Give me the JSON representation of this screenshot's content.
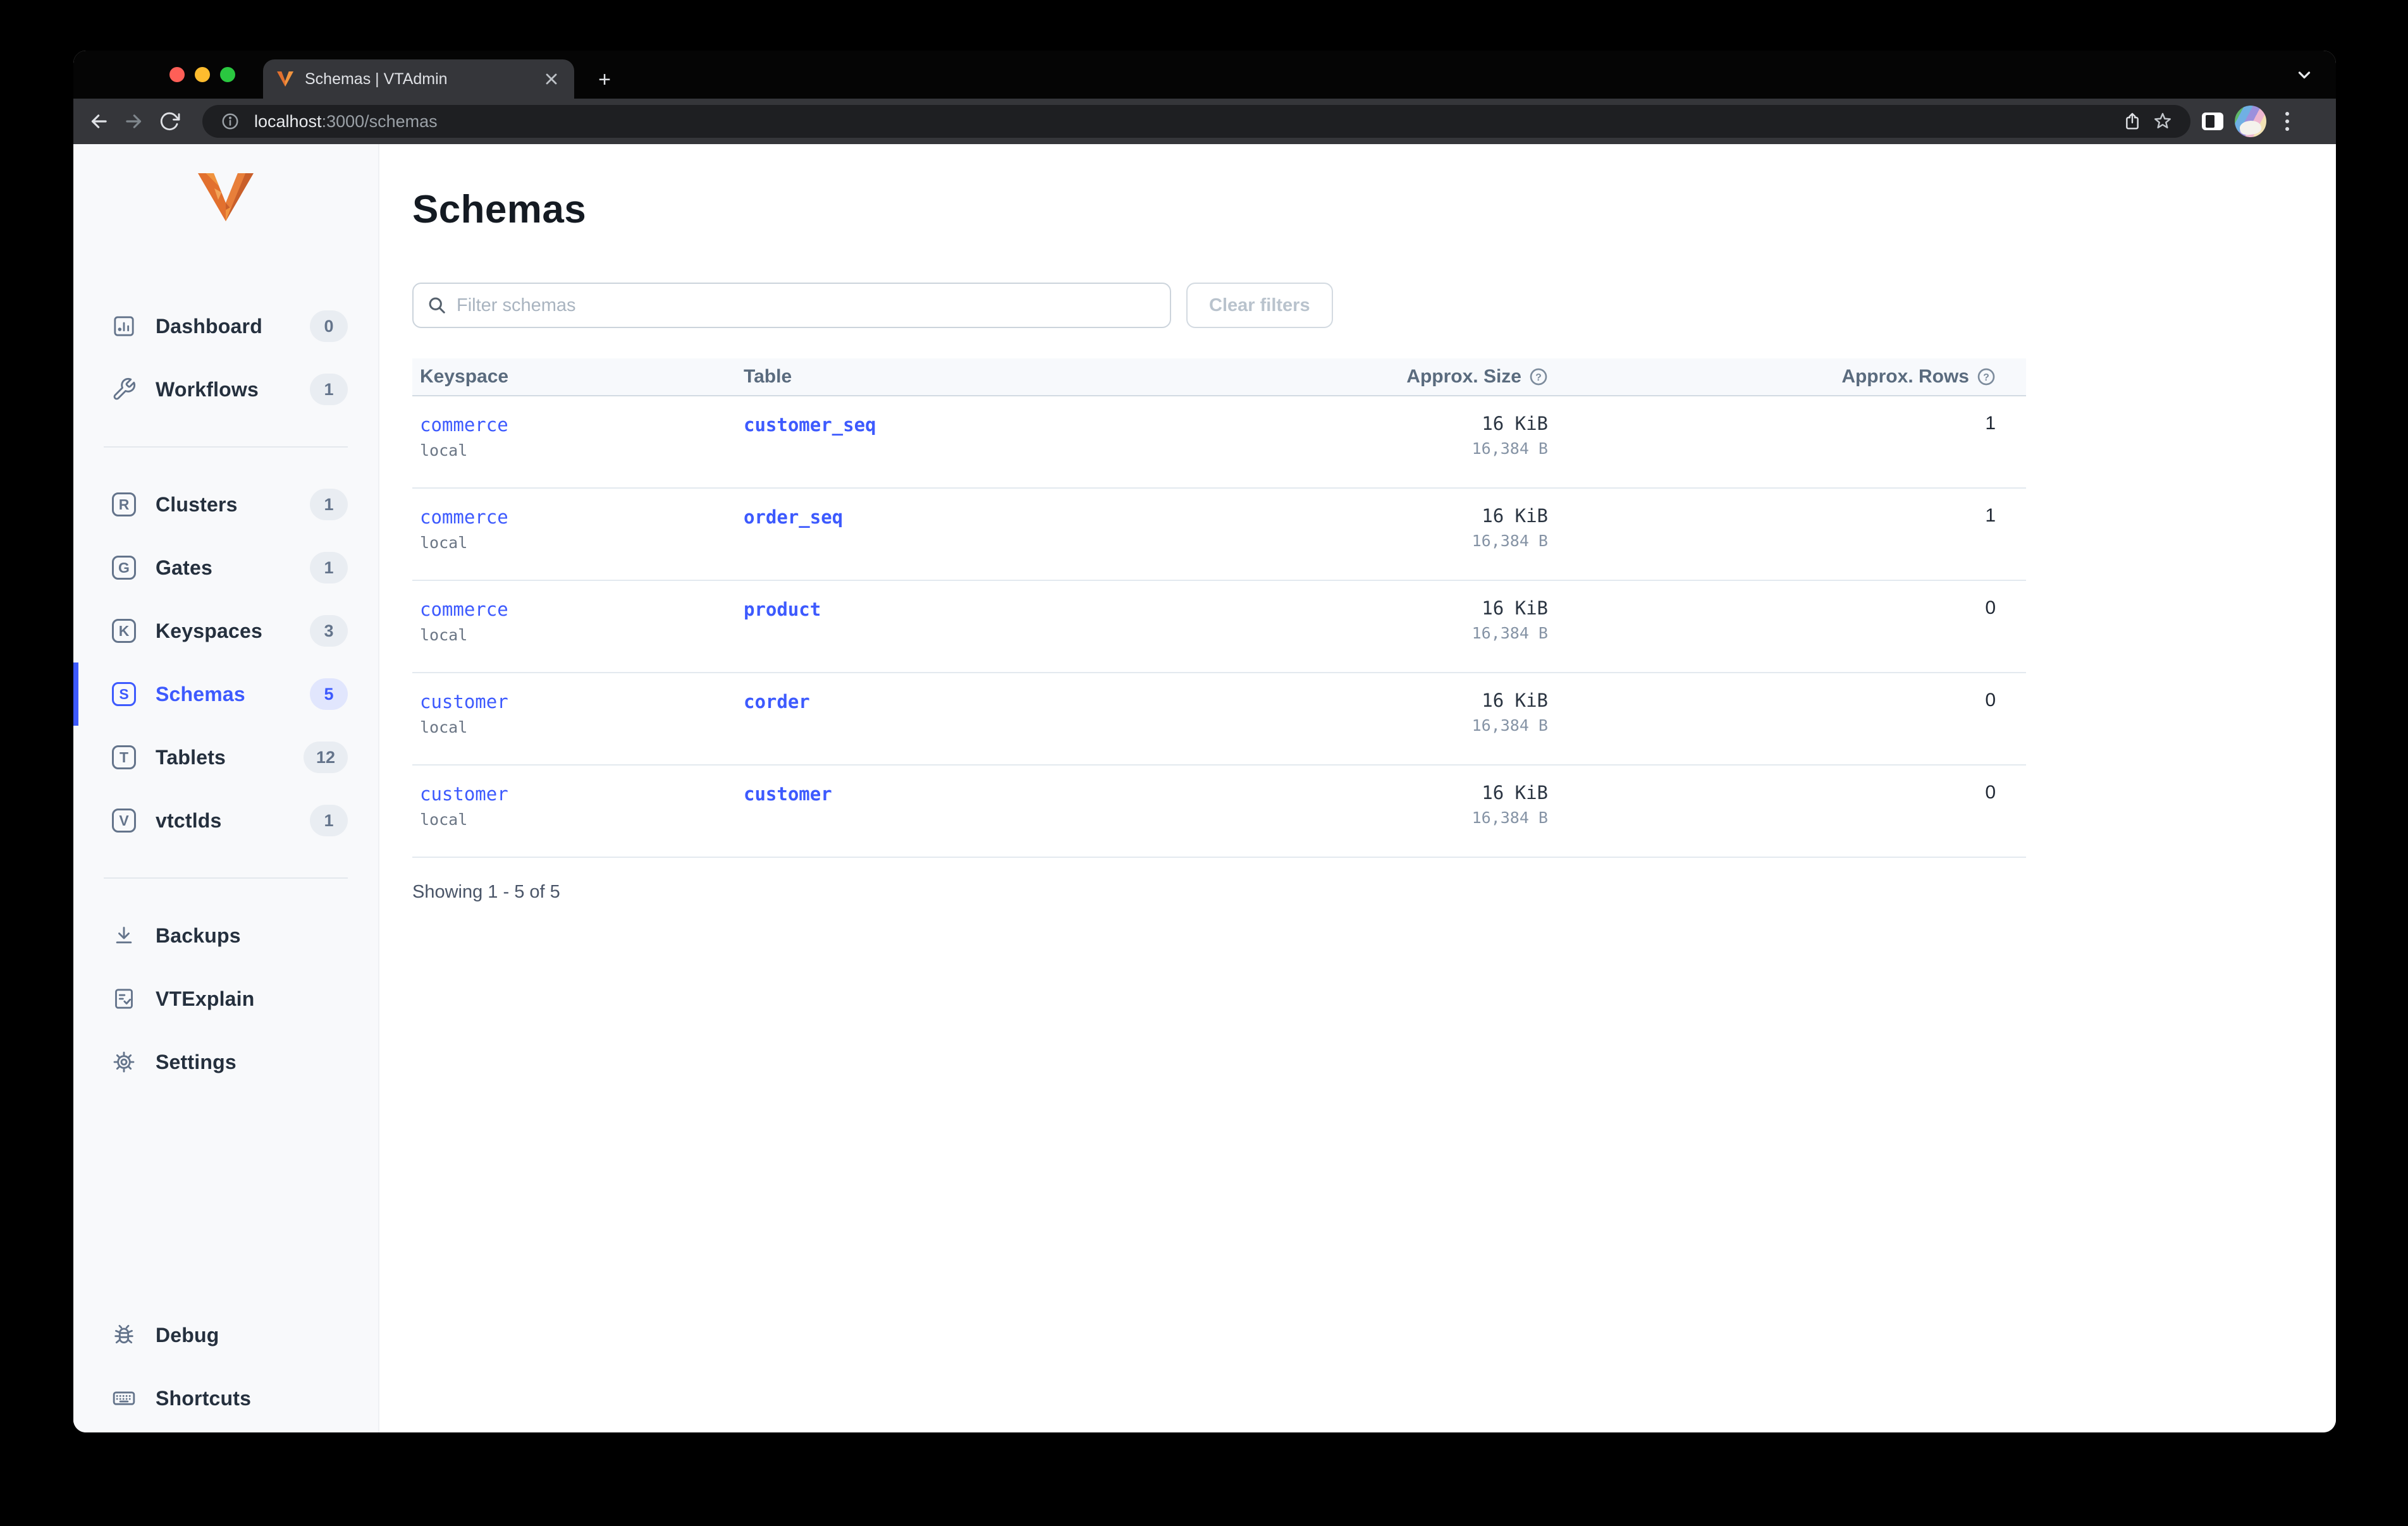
{
  "colors": {
    "accent": "#3d5afe",
    "logo_orange": "#e8682c",
    "sidebar_bg": "#f8f9fb"
  },
  "browser": {
    "tab_title": "Schemas | VTAdmin",
    "url_host": "localhost",
    "url_path": ":3000/schemas",
    "new_tab_label": "+"
  },
  "sidebar": {
    "groups": {
      "primary": [
        {
          "label": "Dashboard",
          "count": "0",
          "icon": "dashboard"
        },
        {
          "label": "Workflows",
          "count": "1",
          "icon": "wrench"
        }
      ],
      "cluster": [
        {
          "label": "Clusters",
          "count": "1",
          "icon": "letter",
          "letter": "R"
        },
        {
          "label": "Gates",
          "count": "1",
          "icon": "letter",
          "letter": "G"
        },
        {
          "label": "Keyspaces",
          "count": "3",
          "icon": "letter",
          "letter": "K"
        },
        {
          "label": "Schemas",
          "count": "5",
          "icon": "letter",
          "letter": "S",
          "active": true
        },
        {
          "label": "Tablets",
          "count": "12",
          "icon": "letter",
          "letter": "T"
        },
        {
          "label": "vtctlds",
          "count": "1",
          "icon": "letter",
          "letter": "V"
        }
      ],
      "tools": [
        {
          "label": "Backups",
          "icon": "download"
        },
        {
          "label": "VTExplain",
          "icon": "listcheck"
        },
        {
          "label": "Settings",
          "icon": "gear"
        }
      ],
      "bottom": [
        {
          "label": "Debug",
          "icon": "bug"
        },
        {
          "label": "Shortcuts",
          "icon": "keyboard"
        }
      ]
    }
  },
  "main": {
    "title": "Schemas",
    "filter_placeholder": "Filter schemas",
    "clear_button_label": "Clear filters",
    "table": {
      "headers": {
        "keyspace": "Keyspace",
        "table": "Table",
        "size": "Approx. Size",
        "rows": "Approx. Rows"
      },
      "rows": [
        {
          "keyspace": "commerce",
          "cluster": "local",
          "table": "customer_seq",
          "size": "16 KiB",
          "size_bytes": "16,384 B",
          "rows": "1"
        },
        {
          "keyspace": "commerce",
          "cluster": "local",
          "table": "order_seq",
          "size": "16 KiB",
          "size_bytes": "16,384 B",
          "rows": "1"
        },
        {
          "keyspace": "commerce",
          "cluster": "local",
          "table": "product",
          "size": "16 KiB",
          "size_bytes": "16,384 B",
          "rows": "0"
        },
        {
          "keyspace": "customer",
          "cluster": "local",
          "table": "corder",
          "size": "16 KiB",
          "size_bytes": "16,384 B",
          "rows": "0"
        },
        {
          "keyspace": "customer",
          "cluster": "local",
          "table": "customer",
          "size": "16 KiB",
          "size_bytes": "16,384 B",
          "rows": "0"
        }
      ]
    },
    "footer": "Showing 1 - 5 of 5"
  }
}
